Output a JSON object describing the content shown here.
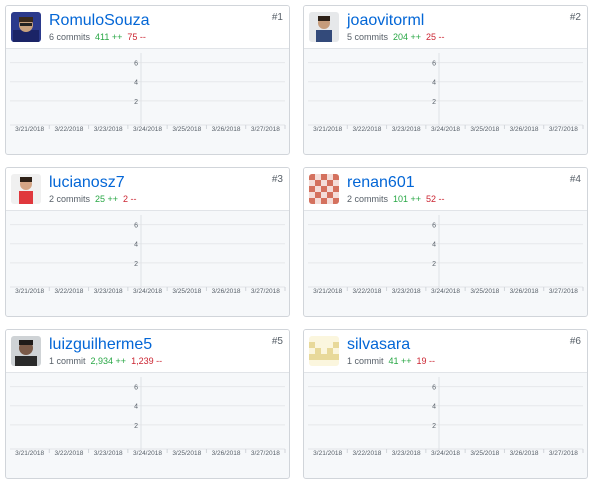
{
  "contributors": [
    {
      "rank": "#1",
      "username": "RomuloSouza",
      "commits": "6 commits",
      "additions": "411 ++",
      "deletions": "75 --",
      "avatar": "photo-dark"
    },
    {
      "rank": "#2",
      "username": "joaovitorml",
      "commits": "5 commits",
      "additions": "204 ++",
      "deletions": "25 --",
      "avatar": "photo-light"
    },
    {
      "rank": "#3",
      "username": "lucianosz7",
      "commits": "2 commits",
      "additions": "25 ++",
      "deletions": "2 --",
      "avatar": "photo-red"
    },
    {
      "rank": "#4",
      "username": "renan601",
      "commits": "2 commits",
      "additions": "101 ++",
      "deletions": "52 --",
      "avatar": "identicon-red"
    },
    {
      "rank": "#5",
      "username": "luizguilherme5",
      "commits": "1 commit",
      "additions": "2,934 ++",
      "deletions": "1,239 --",
      "avatar": "photo-portrait"
    },
    {
      "rank": "#6",
      "username": "silvasara",
      "commits": "1 commit",
      "additions": "41 ++",
      "deletions": "19 --",
      "avatar": "identicon-yellow"
    }
  ],
  "chart_data": {
    "type": "area",
    "categories": [
      "3/21/2018",
      "3/22/2018",
      "3/23/2018",
      "3/24/2018",
      "3/25/2018",
      "3/26/2018",
      "3/27/2018"
    ],
    "yticks": [
      "6",
      "4",
      "2"
    ],
    "ylim": [
      0,
      7
    ]
  }
}
